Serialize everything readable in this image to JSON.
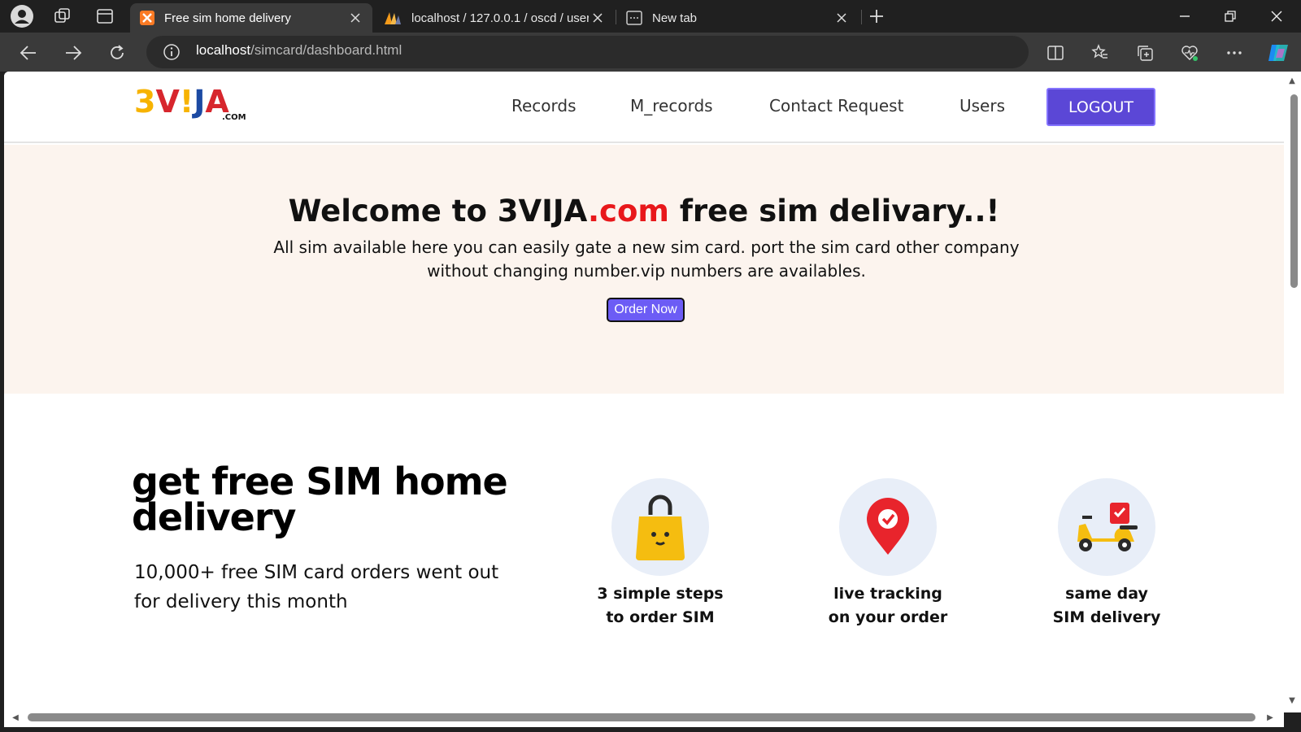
{
  "browser": {
    "tabs": [
      {
        "title": "Free sim home delivery",
        "active": true,
        "icon": "xampp-icon"
      },
      {
        "title": "localhost / 127.0.0.1 / oscd / user",
        "active": false,
        "icon": "phpmyadmin-icon"
      },
      {
        "title": "New tab",
        "active": false,
        "icon": "new-tab-icon"
      }
    ],
    "address": {
      "host": "localhost",
      "path": "/simcard/dashboard.html"
    },
    "accent_color": "#202020"
  },
  "site": {
    "logo": {
      "main": "3VIJA",
      "parts": [
        "3",
        "V",
        "!",
        "J",
        "A"
      ],
      "suffix": ".COM"
    },
    "nav": [
      "Records",
      "M_records",
      "Contact Request",
      "Users"
    ],
    "logout_label": "LOGOUT",
    "hero": {
      "title_pre": "Welcome to 3VIJA",
      "title_accent": ".com",
      "title_post": " free sim delivary..!",
      "description": "All sim available here you can easily gate a new sim card. port the sim card other company without changing number.vip numbers are availables.",
      "order_button": "Order Now"
    },
    "promo": {
      "title": "get free SIM home delivery",
      "subtitle": "10,000+ free SIM card orders went out for delivery this month"
    },
    "features": [
      {
        "line1": "3 simple steps",
        "line2": "to order SIM",
        "icon": "shopping-bag-icon"
      },
      {
        "line1": "live tracking",
        "line2": "on your order",
        "icon": "location-pin-icon"
      },
      {
        "line1": "same day",
        "line2": "SIM delivery",
        "icon": "delivery-scooter-icon"
      }
    ],
    "colors": {
      "primary": "#5b47d6",
      "hero_bg": "#fcf4ee",
      "accent_red": "#e8181b"
    }
  }
}
